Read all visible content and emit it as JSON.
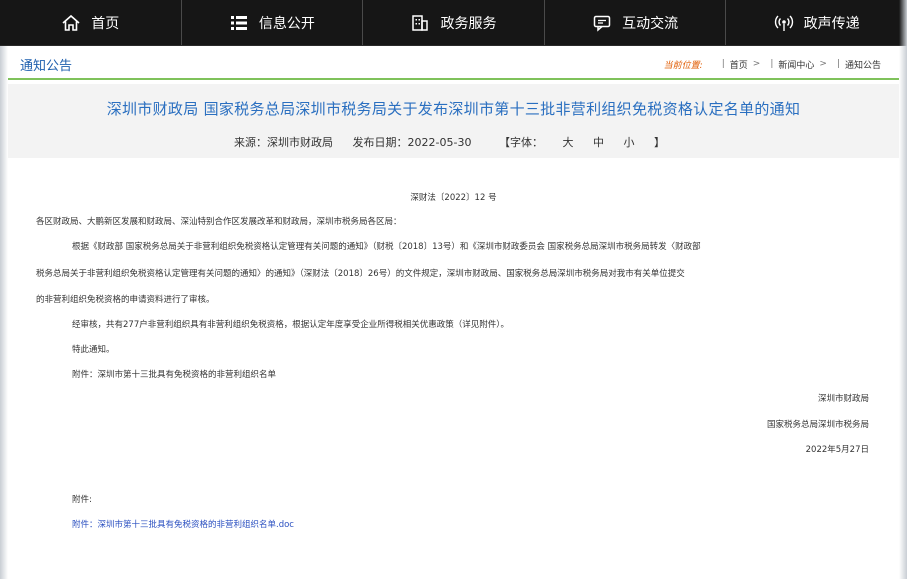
{
  "nav": {
    "items": [
      {
        "label": "首页",
        "icon": "home-icon"
      },
      {
        "label": "信息公开",
        "icon": "list-icon"
      },
      {
        "label": "政务服务",
        "icon": "building-icon"
      },
      {
        "label": "互动交流",
        "icon": "chat-icon"
      },
      {
        "label": "政声传递",
        "icon": "broadcast-icon"
      }
    ]
  },
  "breadcrumb": {
    "section": "通知公告",
    "current_label": "当前位置:",
    "items": [
      "首页",
      "新闻中心",
      "通知公告"
    ],
    "sep": ">"
  },
  "article": {
    "title": "深圳市财政局 国家税务总局深圳市税务局关于发布深圳市第十三批非营利组织免税资格认定名单的通知",
    "source": "来源：深圳市财政局",
    "date": "发布日期：2022-05-30",
    "font_label": "【字体：",
    "font_sizes": [
      "大",
      "中",
      "小"
    ],
    "font_end": "】"
  },
  "body": {
    "doc_no": "深财法〔2022〕12 号",
    "addressee": "各区财政局、大鹏新区发展和财政局、深汕特别合作区发展改革和财政局，深圳市税务局各区局：",
    "p1_l1": "根据《财政部 国家税务总局关于非营利组织免税资格认定管理有关问题的通知》（财税〔2018〕13号）和《深圳市财政委员会 国家税务总局深圳市税务局转发〈财政部",
    "p1_l2": "税务总局关于非营利组织免税资格认定管理有关问题的通知〉的通知》（深财法〔2018〕26号）的文件规定，深圳市财政局、国家税务总局深圳市税务局对我市有关单位提交",
    "p1_l3": "的非营利组织免税资格的申请资料进行了审核。",
    "p2": "经审核，共有277户非营利组织具有非营利组织免税资格，根据认定年度享受企业所得税相关优惠政策（详见附件）。",
    "p3": "特此通知。",
    "attach_line": "附件：深圳市第十三批具有免税资格的非营利组织名单",
    "sign1": "深圳市财政局",
    "sign2": "国家税务总局深圳市税务局",
    "sign_date": "2022年5月27日",
    "attach_header": "附件:",
    "attach_link": "附件：深圳市第十三批具有免税资格的非营利组织名单.doc"
  },
  "colors": {
    "nav_bg": "#161616",
    "title_blue": "#2a6fc0",
    "accent_green": "#7fc25b",
    "link_blue": "#2a4fc0"
  }
}
